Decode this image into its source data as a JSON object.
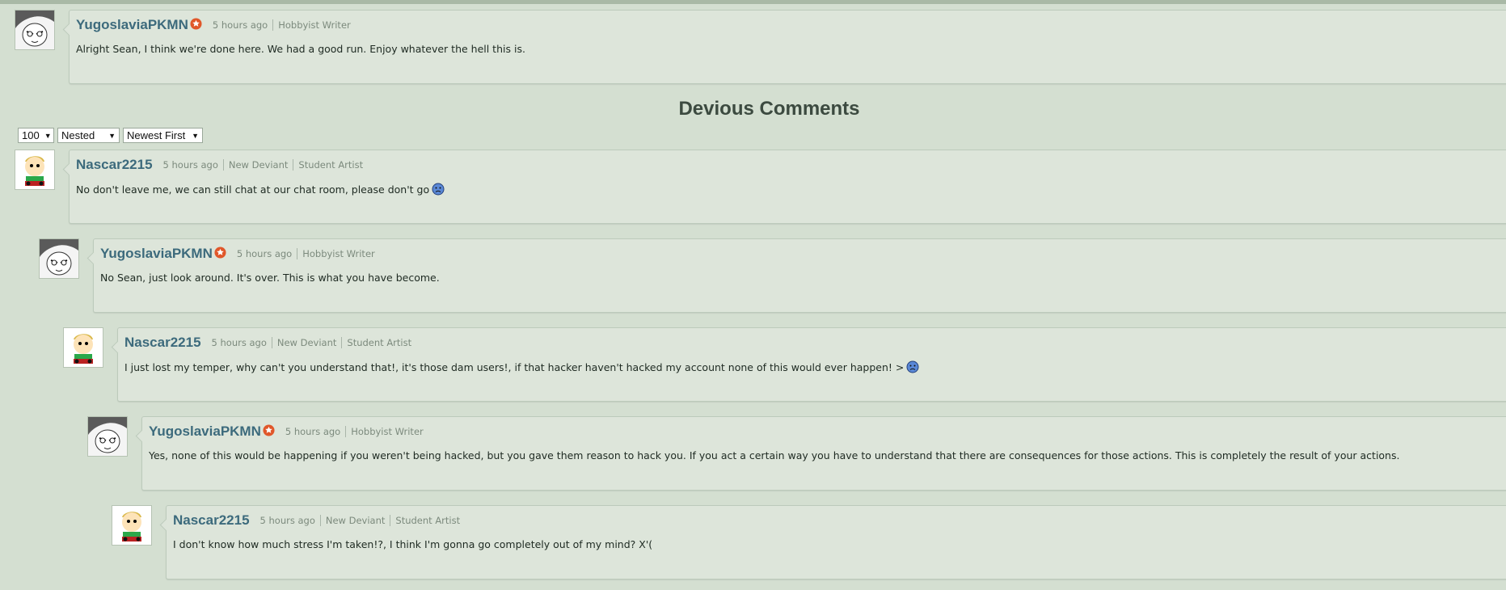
{
  "section_title": "Devious Comments",
  "controls": {
    "count_value": "100",
    "thread_value": "Nested",
    "order_value": "Newest First"
  },
  "icons": {
    "badge": "orange-star-badge-icon",
    "emoticon": "sad-face-emoticon-icon",
    "dropdown": "triangle-down-icon"
  },
  "colors": {
    "page_bg": "#d4dfd1",
    "card_bg": "#dde5da",
    "author": "#3c6a7c",
    "badge": "#e0572a"
  },
  "comments": [
    {
      "author": "YugoslaviaPKMN",
      "time": "5 hours ago",
      "rank": "Hobbyist Writer",
      "text": "Alright Sean, I think we're done here. We had a good run. Enjoy whatever the hell this is."
    },
    {
      "author": "Nascar2215",
      "time": "5 hours ago",
      "rank": "New Deviant",
      "rank2": "Student Artist",
      "text": "No don't leave me, we can still chat at our chat room, please don't go"
    },
    {
      "author": "YugoslaviaPKMN",
      "time": "5 hours ago",
      "rank": "Hobbyist Writer",
      "text": "No Sean, just look around. It's over. This is what you have become."
    },
    {
      "author": "Nascar2215",
      "time": "5 hours ago",
      "rank": "New Deviant",
      "rank2": "Student Artist",
      "text": "I just lost my temper, why can't you understand that!, it's those dam users!, if that hacker haven't hacked my account none of this would ever happen! >"
    },
    {
      "author": "YugoslaviaPKMN",
      "time": "5 hours ago",
      "rank": "Hobbyist Writer",
      "text": "Yes, none of this would be happening if you weren't being hacked, but you gave them reason to hack you. If you act a certain way you have to understand that there are consequences for those actions. This is completely the result of your actions."
    },
    {
      "author": "Nascar2215",
      "time": "5 hours ago",
      "rank": "New Deviant",
      "rank2": "Student Artist",
      "text": "I don't know how much stress I'm taken!?, I think I'm gonna go completely out of my mind? X'("
    }
  ]
}
